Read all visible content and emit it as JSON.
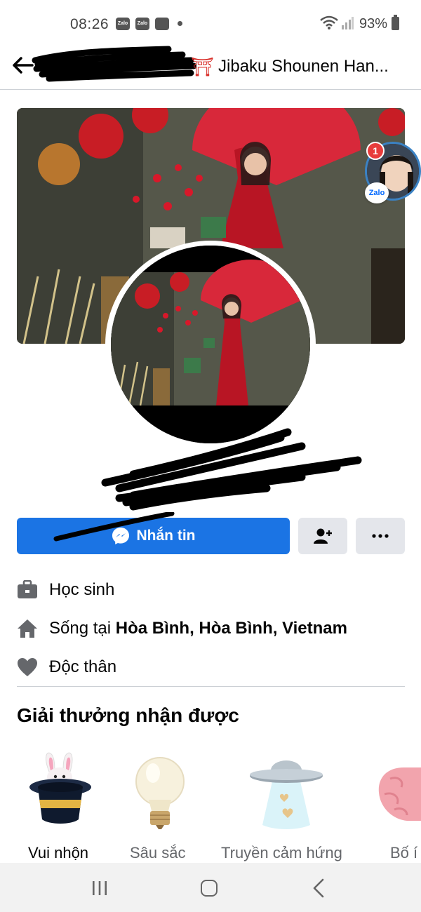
{
  "status_bar": {
    "time": "08:26",
    "app_icons": [
      "Zalo",
      "Zalo"
    ],
    "battery": "93%"
  },
  "header": {
    "title": "Jibaku Shounen Han...",
    "title_emoji": "⛩"
  },
  "chat_head": {
    "badge_count": "1",
    "app_label": "Zalo"
  },
  "actions": {
    "message_label": "Nhắn tin"
  },
  "info": {
    "work": "Học sinh",
    "lives_prefix": "Sống tại ",
    "lives_place": "Hòa Bình, Hòa Bình, Vietnam",
    "relationship": "Độc thân"
  },
  "awards": {
    "title": "Giải thưởng nhận được",
    "items": [
      {
        "label": "Vui nhộn",
        "icon": "magic-hat-rabbit-icon"
      },
      {
        "label": "Sâu sắc",
        "icon": "light-bulb-icon"
      },
      {
        "label": "Truyền cảm hứng",
        "icon": "ufo-icon"
      },
      {
        "label": "Bố í",
        "icon": "brain-icon"
      }
    ]
  },
  "colors": {
    "primary": "#1b74e4",
    "secondary_button": "#e4e6eb",
    "text": "#050505",
    "muted_text": "#65676b",
    "divider": "#ccd0d5"
  }
}
